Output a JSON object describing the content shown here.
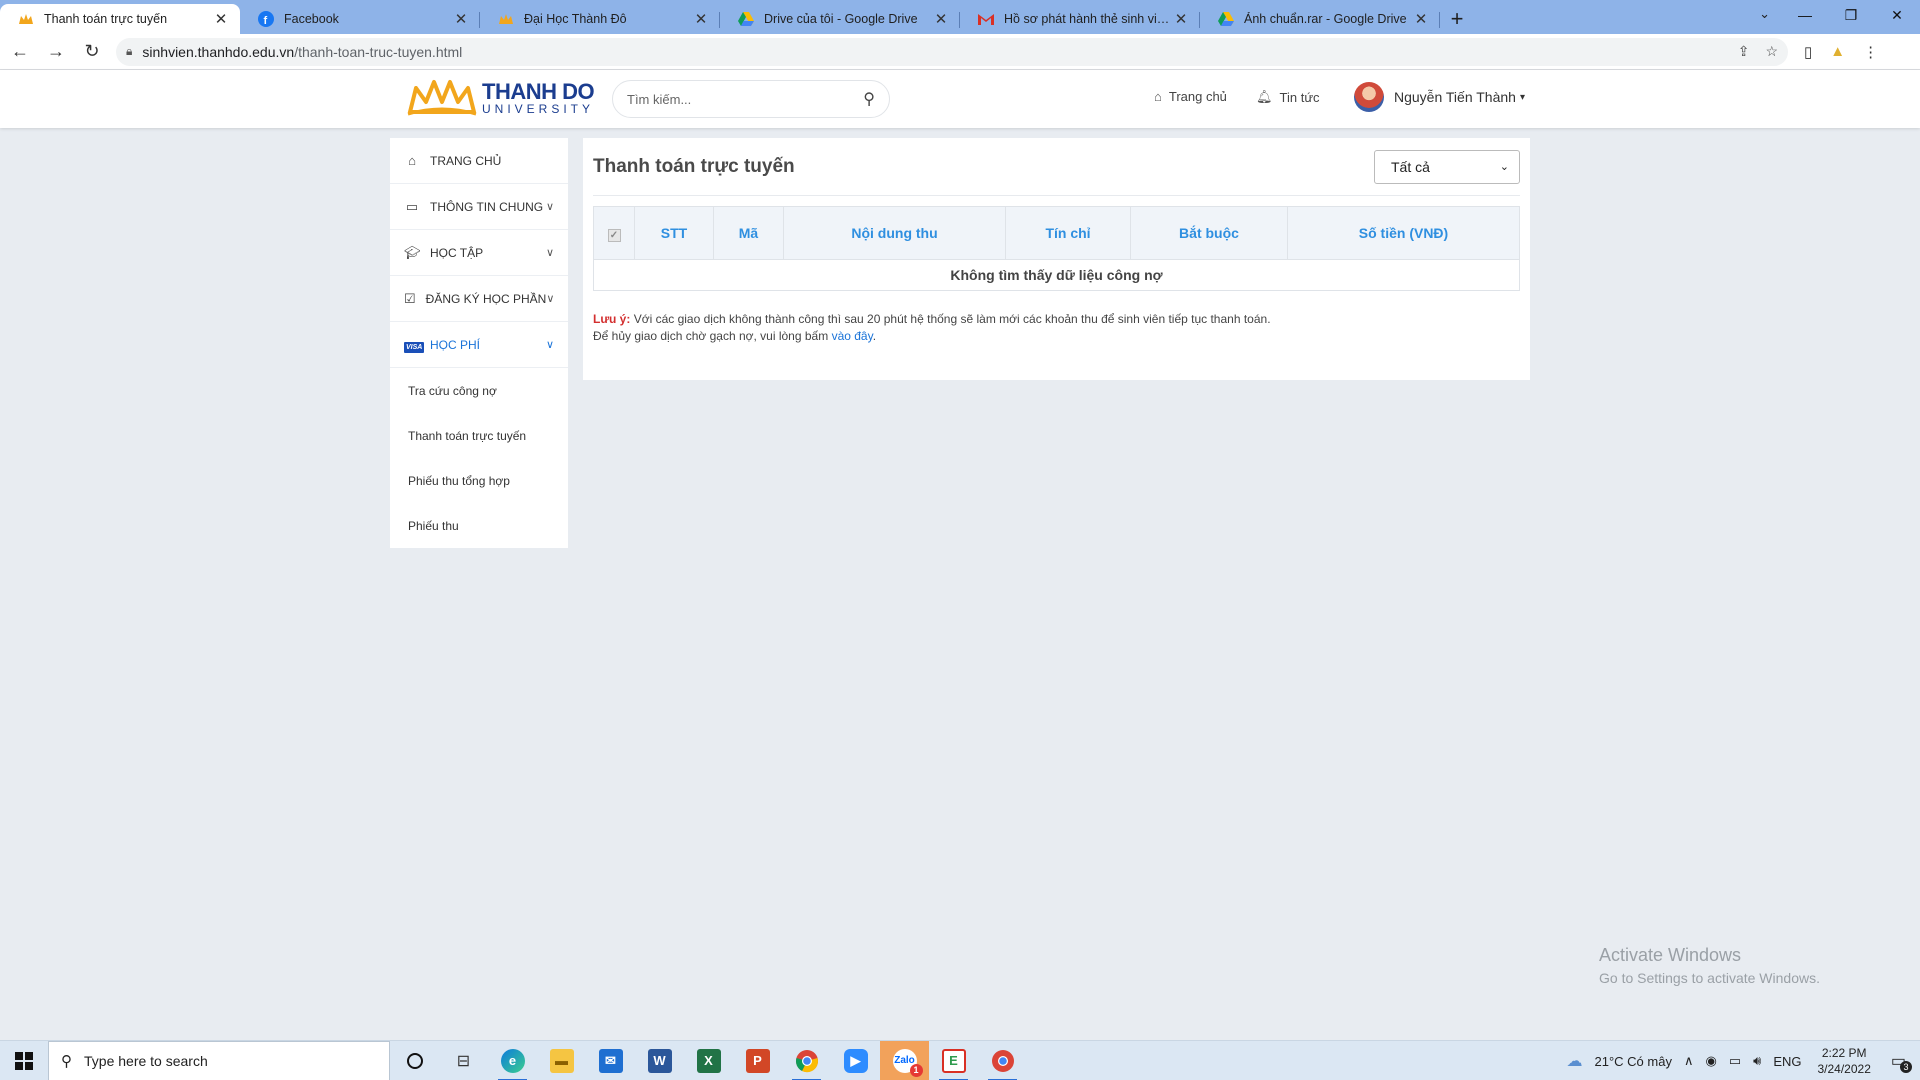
{
  "browser": {
    "tabs": [
      {
        "title": "Thanh toán trực tuyến",
        "icon": "thanhdo-favicon",
        "active": true
      },
      {
        "title": "Facebook",
        "icon": "facebook-icon",
        "active": false
      },
      {
        "title": "Đại Học Thành Đô",
        "icon": "thanhdo-favicon",
        "active": false
      },
      {
        "title": "Drive của tôi - Google Drive",
        "icon": "google-drive-icon",
        "active": false
      },
      {
        "title": "Hồ sơ phát hành thẻ sinh viên liên kết",
        "icon": "gmail-icon",
        "active": false
      },
      {
        "title": "Ảnh chuẩn.rar - Google Drive",
        "icon": "google-drive-icon",
        "active": false
      }
    ],
    "url_host": "sinhvien.thanhdo.edu.vn",
    "url_path": "/thanh-toan-truc-tuyen.html"
  },
  "header": {
    "logo_big": "THANH DO",
    "logo_small": "UNIVERSITY",
    "search_placeholder": "Tìm kiếm...",
    "nav_home": "Trang chủ",
    "nav_news": "Tin tức",
    "user_name": "Nguyễn Tiến Thành"
  },
  "sidebar": {
    "items": [
      {
        "label": "TRANG CHỦ",
        "icon": "home-icon"
      },
      {
        "label": "THÔNG TIN CHUNG",
        "icon": "monitor-icon"
      },
      {
        "label": "HỌC TẬP",
        "icon": "graduation-cap-icon"
      },
      {
        "label": "ĐĂNG KÝ HỌC PHẦN",
        "icon": "check-square-icon"
      },
      {
        "label": "HỌC PHÍ",
        "icon": "visa-card-icon",
        "visa_text": "VISA"
      }
    ],
    "sub_items": [
      {
        "label": "Tra cứu công nợ"
      },
      {
        "label": "Thanh toán trực tuyến"
      },
      {
        "label": "Phiếu thu tổng hợp"
      },
      {
        "label": "Phiếu thu"
      }
    ]
  },
  "main": {
    "title": "Thanh toán trực tuyến",
    "filter_value": "Tất cả",
    "table": {
      "columns": [
        "",
        "STT",
        "Mã",
        "Nội dung thu",
        "Tín chỉ",
        "Bắt buộc",
        "Số tiền (VNĐ)"
      ],
      "empty_message": "Không tìm thấy dữ liệu công nợ"
    },
    "note_label": "Lưu ý:",
    "note_line1": "Với các giao dịch không thành công thì sau 20 phút hệ thống sẽ làm mới các khoản thu để sinh viên tiếp tục thanh toán.",
    "note_line2": "Để hủy giao dịch chờ gạch nợ, vui lòng bấm",
    "note_link": "vào đây",
    "note_end": "."
  },
  "watermark": {
    "line1": "Activate Windows",
    "line2": "Go to Settings to activate Windows."
  },
  "taskbar": {
    "search_placeholder": "Type here to search",
    "weather": "21°C  Có mây",
    "lang": "ENG",
    "time": "2:22 PM",
    "date": "3/24/2022",
    "notification_count": "3",
    "zalo_badge": "1"
  },
  "colors": {
    "accent": "#1a73d8",
    "header_text": "#2f8fe0",
    "warning": "#d32f2f",
    "logo_blue": "#1b3d8f",
    "logo_gold": "#f2a61c"
  }
}
